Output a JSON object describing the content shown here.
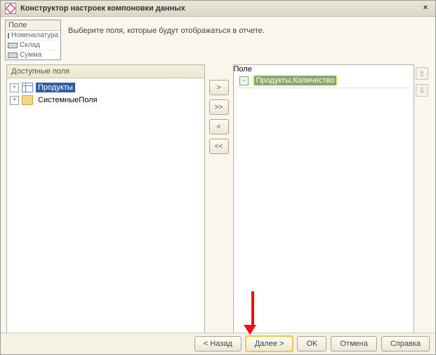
{
  "window": {
    "title": "Конструктор настроек компоновки данных",
    "close": "×"
  },
  "legend": {
    "header": "Поле",
    "items": [
      {
        "label": "Номенклатура"
      },
      {
        "label": "Склад"
      },
      {
        "label": "Сумма"
      }
    ]
  },
  "instruction": "Выберите поля, которые будут отображаться в отчете.",
  "left_panel": {
    "header": "Доступные поля",
    "nodes": [
      {
        "expander": "+",
        "icon": "table",
        "label": "Продукты",
        "selected": true
      },
      {
        "expander": "+",
        "icon": "folder",
        "label": "СистемныеПоля",
        "selected": false
      }
    ]
  },
  "mid_buttons": {
    "add": ">",
    "add_all": ">>",
    "remove": "<",
    "remove_all": "<<"
  },
  "right_panel": {
    "header": "Поле",
    "rows": [
      {
        "expander": "–",
        "label": "Продукты.Количество",
        "highlight": true
      }
    ],
    "arrows": {
      "up": "⇧",
      "down": "⇩"
    }
  },
  "footer": {
    "back": "< Назад",
    "next": "Далее >",
    "ok": "OK",
    "cancel": "Отмена",
    "help": "Справка"
  }
}
